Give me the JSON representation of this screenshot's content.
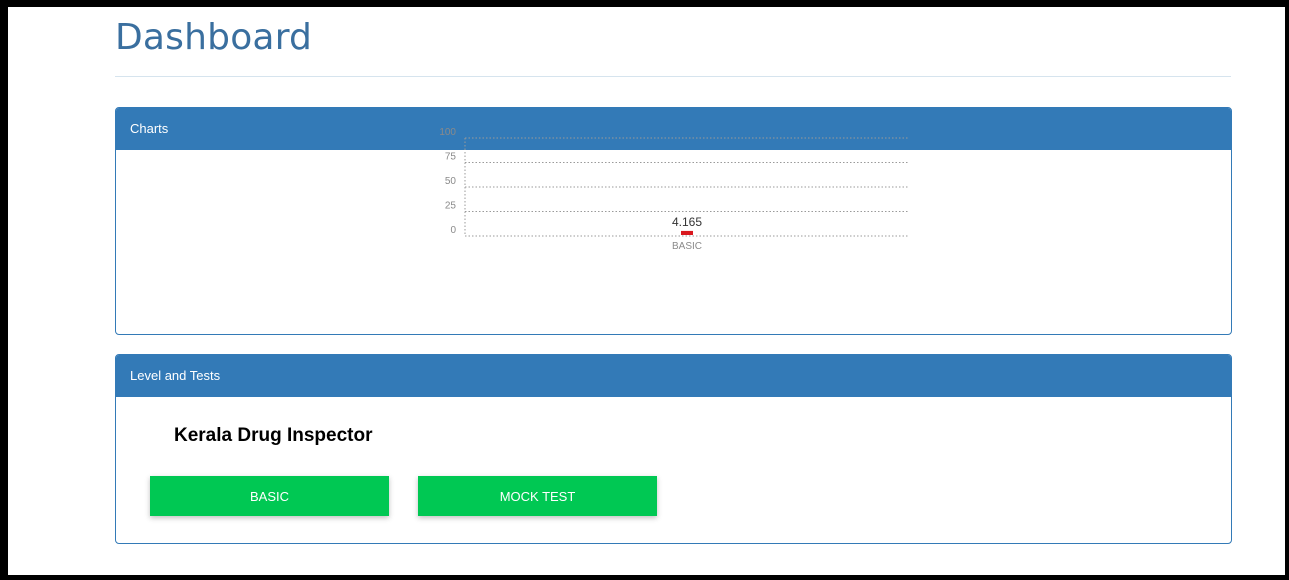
{
  "page": {
    "title": "Dashboard"
  },
  "charts_panel": {
    "heading": "Charts"
  },
  "levels_panel": {
    "heading": "Level and Tests",
    "course_title": "Kerala Drug Inspector",
    "buttons": [
      {
        "label": "BASIC"
      },
      {
        "label": "MOCK TEST"
      }
    ]
  },
  "colors": {
    "brand": "#337ab7",
    "title": "#3a6f9f",
    "button": "#00c853",
    "bar": "#d9181e"
  },
  "chart_data": {
    "type": "bar",
    "categories": [
      "BASIC"
    ],
    "values": [
      4.165
    ],
    "data_labels": [
      "4.165"
    ],
    "yticks": [
      0,
      25,
      50,
      75,
      100
    ],
    "ylim": [
      0,
      100
    ],
    "grid": true,
    "legend": "none",
    "bar_color": "#d9181e"
  }
}
